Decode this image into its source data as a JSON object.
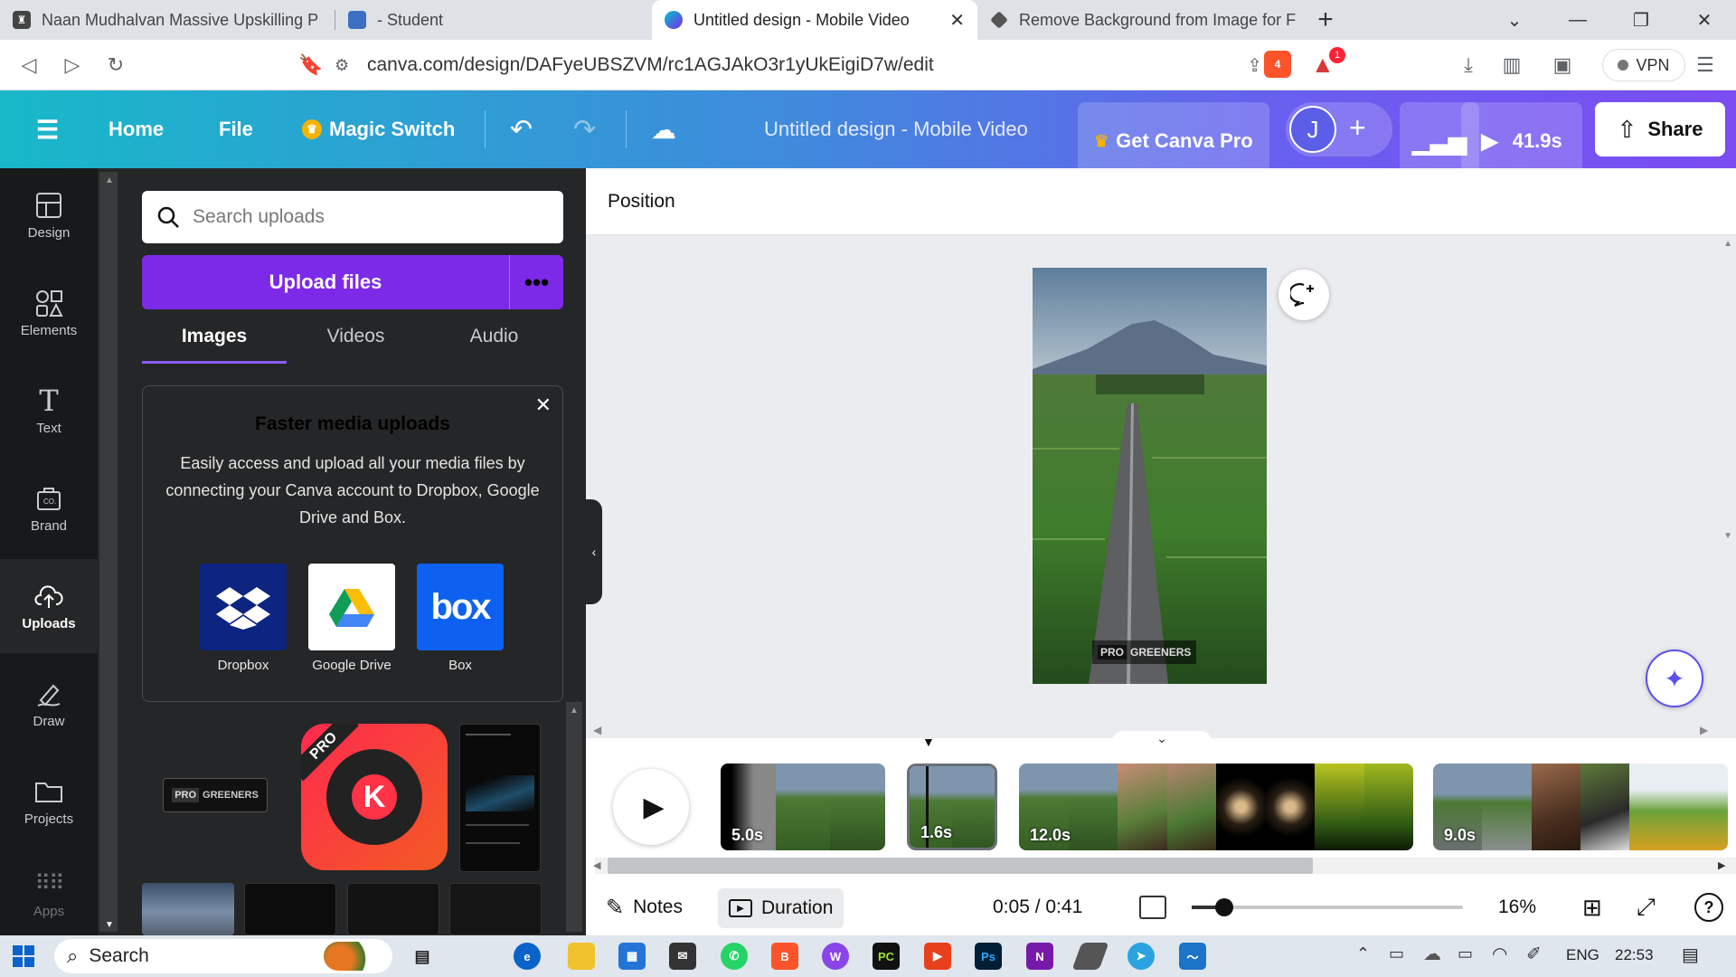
{
  "browser": {
    "tabs": [
      {
        "title": "Naan Mudhalvan Massive Upskilling P",
        "active": false
      },
      {
        "title": "- Student",
        "active": false
      },
      {
        "title": "Untitled design - Mobile Video",
        "active": true
      },
      {
        "title": "Remove Background from Image for F",
        "active": false
      }
    ],
    "url": "canva.com/design/DAFyeUBSZVM/rc1AGJAkO3r1yUkEigiD7w/edit",
    "brave_badge": "4",
    "rewards_badge": "1",
    "vpn_label": "VPN"
  },
  "header": {
    "home": "Home",
    "file": "File",
    "magic_switch": "Magic Switch",
    "design_title": "Untitled design - Mobile Video",
    "get_pro": "Get Canva Pro",
    "avatar_initial": "J",
    "play_duration": "41.9s",
    "share": "Share"
  },
  "rail": [
    {
      "label": "Design",
      "icon": "layout-icon"
    },
    {
      "label": "Elements",
      "icon": "shapes-icon"
    },
    {
      "label": "Text",
      "icon": "text-icon"
    },
    {
      "label": "Brand",
      "icon": "brand-icon"
    },
    {
      "label": "Uploads",
      "icon": "cloud-upload-icon",
      "active": true
    },
    {
      "label": "Draw",
      "icon": "pen-icon"
    },
    {
      "label": "Projects",
      "icon": "folder-icon"
    },
    {
      "label": "Apps",
      "icon": "grid-icon"
    }
  ],
  "uploads": {
    "search_placeholder": "Search uploads",
    "upload_button": "Upload files",
    "tabs": [
      "Images",
      "Videos",
      "Audio"
    ],
    "promo_title": "Faster media uploads",
    "promo_body": "Easily access and upload all your media files by connecting your Canva account to Dropbox, Google Drive and Box.",
    "connectors": [
      "Dropbox",
      "Google Drive",
      "Box"
    ],
    "thumb_logo_text_a": "PRO",
    "thumb_logo_text_b": "GREENERS",
    "kinemaster_letter": "K",
    "kinemaster_ribbon": "PRO"
  },
  "editor": {
    "position_label": "Position",
    "watermark_a": "PRO",
    "watermark_b": "GREENERS"
  },
  "timeline": {
    "clips": [
      {
        "duration": "5.0s"
      },
      {
        "duration": "1.6s"
      },
      {
        "duration": "12.0s"
      },
      {
        "duration": "9.0s"
      }
    ],
    "notes": "Notes",
    "duration_label": "Duration",
    "time": "0:05 / 0:41",
    "zoom": "16%"
  },
  "taskbar": {
    "search": "Search",
    "lang": "ENG",
    "clock": "22:53"
  },
  "colors": {
    "canva_purple": "#7d2ae8",
    "panel_dark": "#252627",
    "rail_dark": "#18191b"
  }
}
